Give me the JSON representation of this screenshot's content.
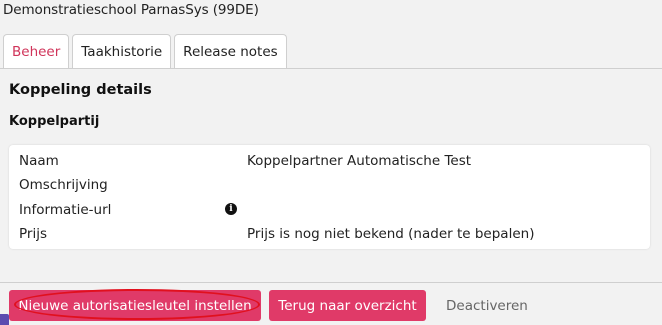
{
  "header": {
    "school": "Demonstratieschool ParnasSys (99DE)"
  },
  "tabs": [
    {
      "label": "Beheer",
      "active": true
    },
    {
      "label": "Taakhistorie",
      "active": false
    },
    {
      "label": "Release notes",
      "active": false
    }
  ],
  "main": {
    "title": "Koppeling details",
    "section": "Koppelpartij",
    "fields": [
      {
        "label": "Naam",
        "value": "Koppelpartner Automatische Test"
      },
      {
        "label": "Omschrijving",
        "value": ""
      },
      {
        "label": "Informatie-url",
        "value": "",
        "icon": "info-icon"
      },
      {
        "label": "Prijs",
        "value": "Prijs is nog niet bekend (nader te bepalen)"
      }
    ]
  },
  "actions": {
    "new_key": "Nieuwe autorisatiesleutel instellen",
    "back": "Terug naar overzicht",
    "deactivate": "Deactiveren"
  },
  "colors": {
    "accent": "#e03a68",
    "active_tab_text": "#d0345a",
    "highlight": "#e1101e",
    "background": "#f2f2f2"
  }
}
